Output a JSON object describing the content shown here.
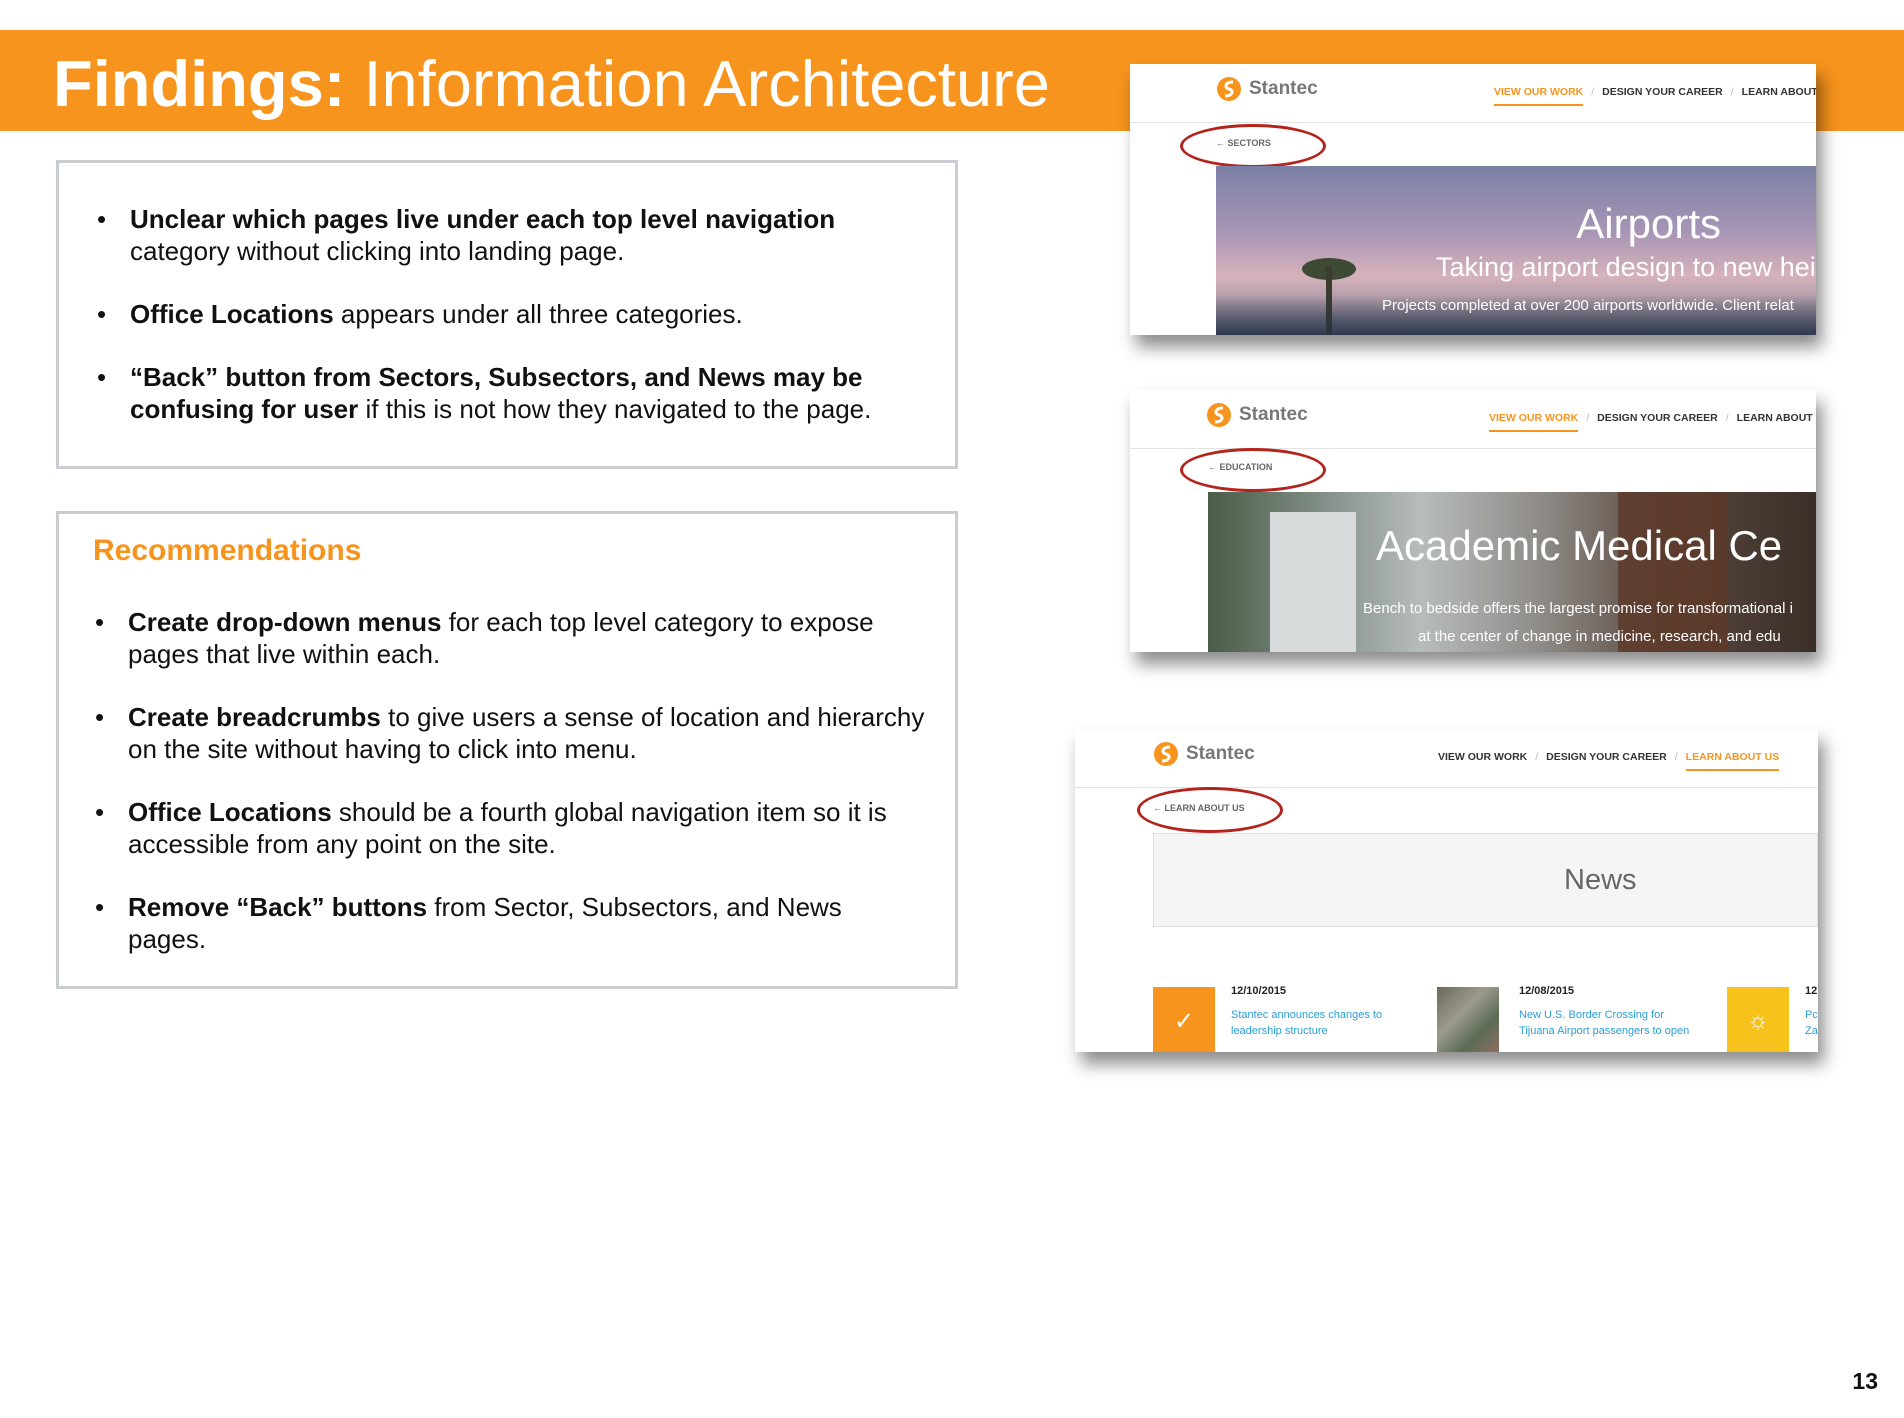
{
  "header": {
    "title_bold": "Findings:",
    "title_rest": " Information Architecture"
  },
  "findings": {
    "items": [
      {
        "bold": "Unclear which pages live under each top level navigation",
        "text": " category without clicking into landing page."
      },
      {
        "bold": "Office Locations",
        "text": " appears under all three categories."
      },
      {
        "bold": "“Back” button from Sectors, Subsectors, and News may be confusing for user",
        "text": " if this is not how they navigated to the page."
      }
    ]
  },
  "recommendations": {
    "title": "Recommendations",
    "items": [
      {
        "bold": "Create drop-down menus",
        "text": " for each top level category to expose pages that live within each."
      },
      {
        "bold": "Create breadcrumbs",
        "text": " to give users a sense of location and hierarchy on the site without having to click into menu."
      },
      {
        "bold": "Office Locations",
        "text": " should be a fourth global navigation item so it is accessible from any point on the site."
      },
      {
        "bold": "Remove “Back” buttons",
        "text": " from Sector, Subsectors, and News pages."
      }
    ]
  },
  "screenshots": {
    "brand": "Stantec",
    "shot1": {
      "nav": [
        "VIEW OUR WORK",
        "DESIGN YOUR CAREER",
        "LEARN ABOUT"
      ],
      "crumb": "← SECTORS",
      "hero_title": "Airports",
      "hero_sub": "Taking airport design to new hei",
      "hero_line": "Projects completed at over 200 airports worldwide. Client relat"
    },
    "shot2": {
      "nav": [
        "VIEW OUR WORK",
        "DESIGN YOUR CAREER",
        "LEARN ABOUT I"
      ],
      "crumb": "← EDUCATION",
      "hero_title": "Academic Medical Ce",
      "hero_line1": "Bench to bedside offers the largest promise for transformational i",
      "hero_line2": "at the center of change in medicine, research, and edu"
    },
    "shot3": {
      "nav": [
        "VIEW OUR WORK",
        "DESIGN YOUR CAREER",
        "LEARN ABOUT US"
      ],
      "crumb": "← LEARN ABOUT US",
      "section_title": "News",
      "news": [
        {
          "date": "12/10/2015",
          "line1": "Stantec announces changes to",
          "line2": "leadership structure"
        },
        {
          "date": "12/08/2015",
          "line1": "New U.S. Border Crossing for",
          "line2": "Tijuana Airport passengers to open"
        },
        {
          "date": "12",
          "line1": "Pc",
          "line2": "Za"
        }
      ]
    }
  },
  "page_number": "13",
  "colors": {
    "accent": "#f7941d",
    "highlight_oval": "#b3241c",
    "link": "#2a9fd8"
  },
  "icons": [
    "stantec-logo-icon",
    "back-arrow-icon",
    "checkmark-icon",
    "lightbulb-icon"
  ]
}
